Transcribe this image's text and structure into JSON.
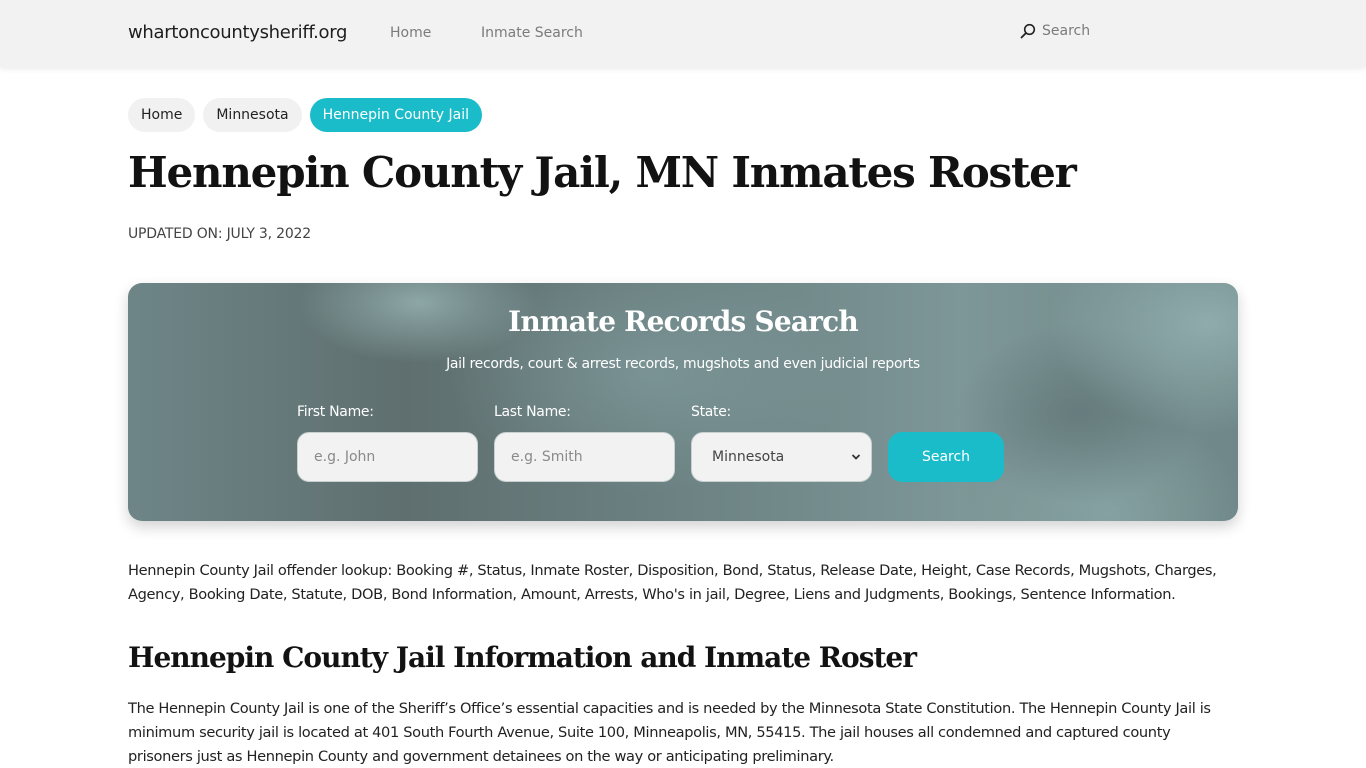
{
  "navbar": {
    "brand": "whartoncountysheriff.org",
    "links": [
      {
        "label": "Home"
      },
      {
        "label": "Inmate Search"
      }
    ],
    "search": {
      "icon": "search-icon",
      "label": "Search"
    }
  },
  "breadcrumb": [
    {
      "label": "Home",
      "active": false
    },
    {
      "label": "Minnesota",
      "active": false
    },
    {
      "label": "Hennepin County Jail",
      "active": true
    }
  ],
  "page": {
    "title": "Hennepin County Jail, MN Inmates Roster",
    "updated": "UPDATED ON: JULY 3, 2022"
  },
  "search_card": {
    "title": "Inmate Records Search",
    "subtitle": "Jail records, court & arrest records, mugshots and even judicial reports",
    "first_name": {
      "label": "First Name:",
      "placeholder": "e.g. John",
      "value": ""
    },
    "last_name": {
      "label": "Last Name:",
      "placeholder": "e.g. Smith",
      "value": ""
    },
    "state": {
      "label": "State:",
      "selected": "Minnesota",
      "icon": "chevron-down-icon"
    },
    "submit_label": "Search"
  },
  "intro_text": "Hennepin County Jail offender lookup: Booking #, Status, Inmate Roster, Disposition, Bond, Status, Release Date, Height, Case Records, Mugshots, Charges, Agency, Booking Date, Statute, DOB, Bond Information, Amount, Arrests, Who's in jail, Degree, Liens and Judgments, Bookings, Sentence Information.",
  "section": {
    "title": "Hennepin County Jail Information and Inmate Roster",
    "body": "The Hennepin County Jail is one of the Sheriff’s Office’s essential capacities and is needed by the Minnesota State Constitution. The Hennepin County Jail is minimum security jail is located at 401 South Fourth Avenue, Suite 100, Minneapolis, MN, 55415. The jail houses all condemned and captured county prisoners just as Hennepin County and government detainees on the way or anticipating preliminary."
  },
  "colors": {
    "accent": "#1bbcc9",
    "navbar_bg": "#f2f2f2",
    "card_bg": "#6c8283"
  }
}
